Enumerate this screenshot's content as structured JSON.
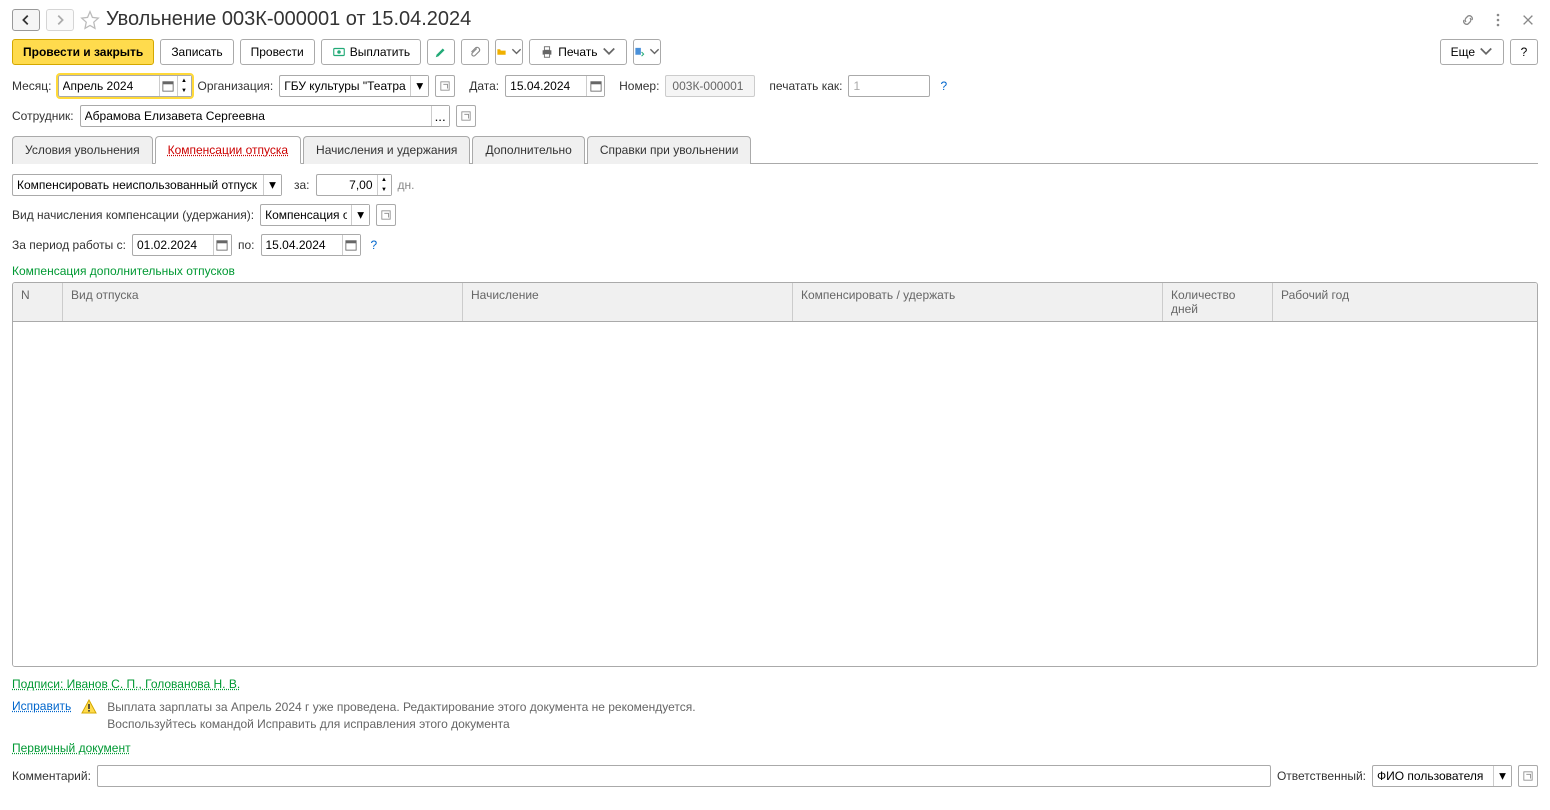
{
  "header": {
    "title": "Увольнение 003К-000001 от 15.04.2024"
  },
  "toolbar": {
    "post_close": "Провести и закрыть",
    "write": "Записать",
    "post": "Провести",
    "pay": "Выплатить",
    "print": "Печать",
    "more": "Еще",
    "help": "?"
  },
  "form": {
    "month_label": "Месяц:",
    "month_value": "Апрель 2024",
    "org_label": "Организация:",
    "org_value": "ГБУ культуры \"Театральн",
    "date_label": "Дата:",
    "date_value": "15.04.2024",
    "number_label": "Номер:",
    "number_value": "003К-000001",
    "print_as_label": "печатать как:",
    "print_as_value": "1",
    "employee_label": "Сотрудник:",
    "employee_value": "Абрамова Елизавета Сергеевна"
  },
  "tabs": {
    "t1": "Условия увольнения",
    "t2": "Компенсации отпуска",
    "t3": "Начисления и удержания",
    "t4": "Дополнительно",
    "t5": "Справки при увольнении"
  },
  "comp": {
    "action": "Компенсировать неиспользованный отпуск",
    "for_label": "за:",
    "days_value": "7,00",
    "days_unit": "дн.",
    "accrual_label": "Вид начисления компенсации (удержания):",
    "accrual_value": "Компенсация отп",
    "period_label": "За период работы с:",
    "period_from": "01.02.2024",
    "period_to_label": "по:",
    "period_to": "15.04.2024",
    "section_title": "Компенсация дополнительных отпусков",
    "cols": {
      "n": "N",
      "type": "Вид отпуска",
      "accrual": "Начисление",
      "comp": "Компенсировать / удержать",
      "days": "Количество дней",
      "year": "Рабочий год"
    }
  },
  "footer": {
    "signatures": "Подписи: Иванов С. П., Голованова Н. В.",
    "fix": "Исправить",
    "warning1": "Выплата зарплаты за Апрель 2024 г уже проведена. Редактирование этого документа не рекомендуется.",
    "warning2": "Воспользуйтесь командой Исправить для исправления этого документа",
    "primary_doc": "Первичный документ",
    "comment_label": "Комментарий:",
    "responsible_label": "Ответственный:",
    "responsible_value": "ФИО пользователя"
  }
}
